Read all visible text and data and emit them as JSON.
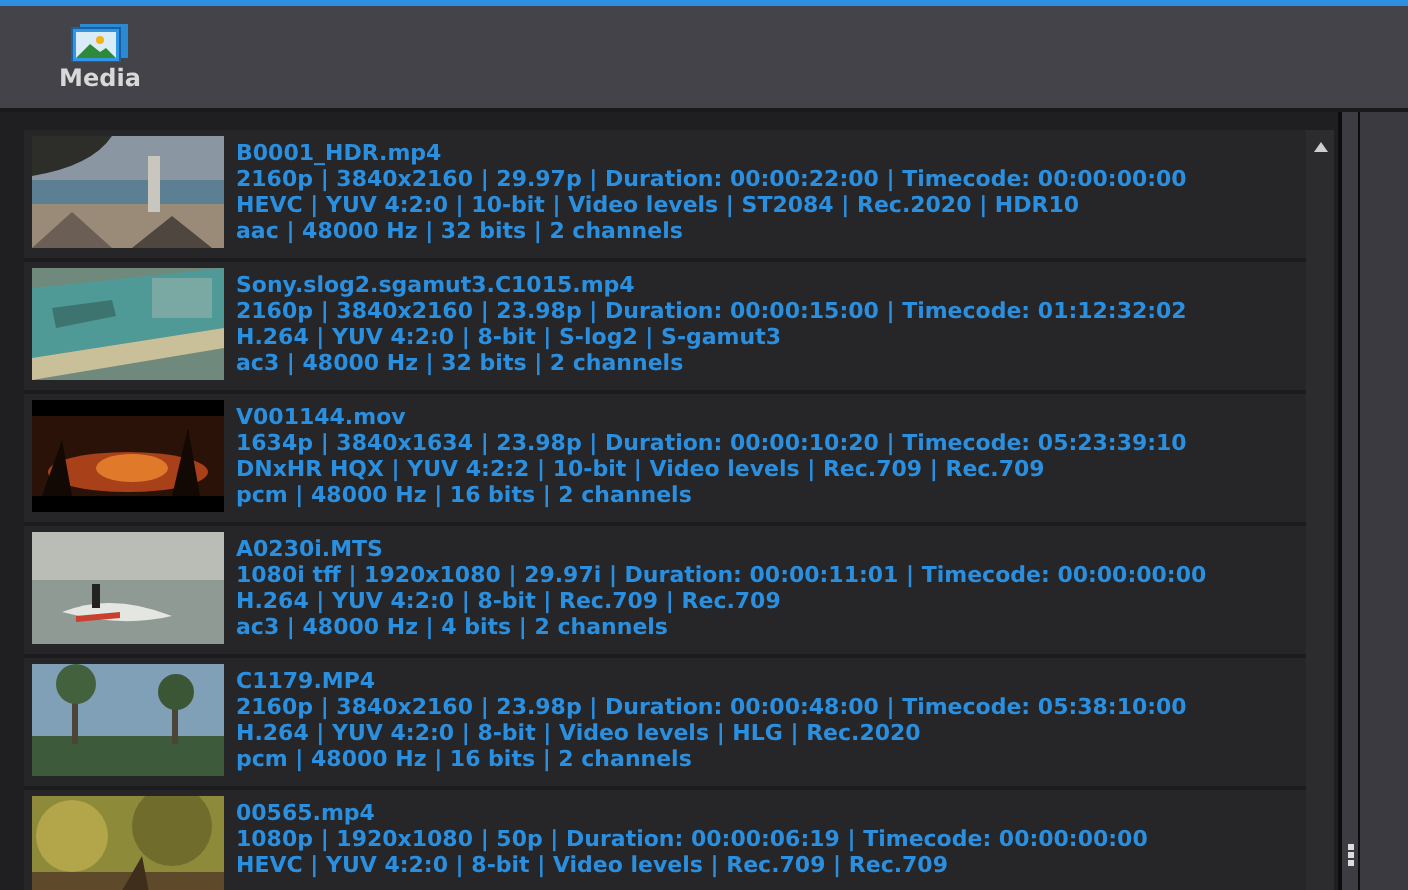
{
  "toolbar": {
    "label": "Media"
  },
  "media": [
    {
      "name": "B0001_HDR.mp4",
      "lines": [
        "2160p | 3840x2160 | 29.97p  | Duration:  00:00:22:00 | Timecode: 00:00:00:00",
        "HEVC | YUV 4:2:0 | 10-bit | Video levels | ST2084 | Rec.2020 | HDR10",
        "aac | 48000 Hz | 32 bits | 2 channels"
      ]
    },
    {
      "name": "Sony.slog2.sgamut3.C1015.mp4",
      "lines": [
        "2160p | 3840x2160 | 23.98p | Duration:  00:00:15:00 | Timecode: 01:12:32:02",
        "H.264 | YUV 4:2:0 | 8-bit | S-log2 | S-gamut3",
        "ac3 | 48000 Hz | 32 bits | 2 channels"
      ]
    },
    {
      "name": "V001144.mov",
      "lines": [
        "1634p | 3840x1634 | 23.98p  | Duration:  00:00:10:20 | Timecode: 05:23:39:10",
        "DNxHR HQX | YUV 4:2:2 | 10-bit | Video levels | Rec.709 | Rec.709",
        "pcm | 48000 Hz | 16 bits | 2 channels"
      ]
    },
    {
      "name": "A0230i.MTS",
      "lines": [
        "1080i tff | 1920x1080 | 29.97i | Duration:  00:00:11:01 | Timecode: 00:00:00:00",
        "H.264 | YUV 4:2:0 | 8-bit | Rec.709 | Rec.709",
        "ac3 | 48000 Hz | 4 bits | 2 channels"
      ]
    },
    {
      "name": "C1179.MP4",
      "lines": [
        "2160p | 3840x2160 | 23.98p  | Duration:  00:00:48:00 | Timecode: 05:38:10:00",
        "H.264 | YUV 4:2:0 | 8-bit | Video levels | HLG | Rec.2020",
        "pcm | 48000 Hz | 16 bits | 2 channels"
      ]
    },
    {
      "name": "00565.mp4",
      "lines": [
        "1080p | 1920x1080 | 50p | Duration:  00:00:06:19 | Timecode: 00:00:00:00",
        "HEVC | YUV 4:2:0 | 8-bit | Video levels | Rec.709 | Rec.709"
      ]
    }
  ]
}
